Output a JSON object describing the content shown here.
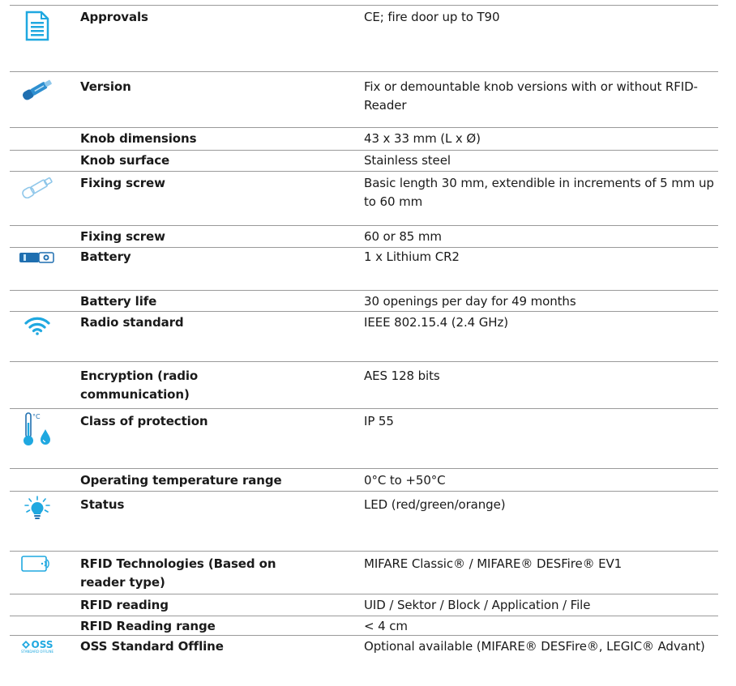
{
  "colors": {
    "icon_blue": "#1fa8e0",
    "rule": "#9a9a9a"
  },
  "rows": [
    {
      "icon": "document-icon",
      "label": "Approvals",
      "value": "CE; fire door up to T90"
    },
    {
      "icon": "knob-cylinder-icon",
      "label": "Version",
      "value": "Fix or demountable knob versions with or without RFID-Reader"
    },
    {
      "icon": "",
      "label": "Knob dimensions",
      "value": "43 x 33 mm (L x Ø)"
    },
    {
      "icon": "",
      "label": "Knob surface",
      "value": "Stainless steel"
    },
    {
      "icon": "screw-icon",
      "label": "Fixing screw",
      "value": "Basic length 30 mm, extendible in increments of 5 mm up to 60 mm"
    },
    {
      "icon": "",
      "label": "Fixing screw",
      "value": "60 or 85 mm"
    },
    {
      "icon": "battery-icon",
      "label": "Battery",
      "value": "1 x Lithium CR2"
    },
    {
      "icon": "",
      "label": "Battery life",
      "value": "30 openings per day for 49 months"
    },
    {
      "icon": "wifi-icon",
      "label": "Radio standard",
      "value": "IEEE 802.15.4 (2.4 GHz)"
    },
    {
      "icon": "",
      "label": "Encryption (radio communication)",
      "value": "AES 128 bits"
    },
    {
      "icon": "thermometer-drop-icon",
      "label": "Class of protection",
      "value": "IP 55"
    },
    {
      "icon": "",
      "label": "Operating temperature range",
      "value": "0°C to +50°C"
    },
    {
      "icon": "light-bulb-icon",
      "label": "Status",
      "value": "LED (red/green/orange)"
    },
    {
      "icon": "rfid-card-icon",
      "label": "RFID Technologies (Based on reader type)",
      "value": "MIFARE Classic® / MIFARE® DESFire® EV1"
    },
    {
      "icon": "",
      "label": "RFID reading",
      "value": "UID / Sektor / Block / Application / File"
    },
    {
      "icon": "",
      "label": "RFID Reading range",
      "value": "< 4 cm"
    },
    {
      "icon": "oss-logo-icon",
      "label": "OSS Standard Offline",
      "value": "Optional available (MIFARE® DESFire®, LEGIC® Advant)",
      "logo_text": "OSS",
      "logo_subtext": "STANDARD OFFLINE"
    }
  ]
}
